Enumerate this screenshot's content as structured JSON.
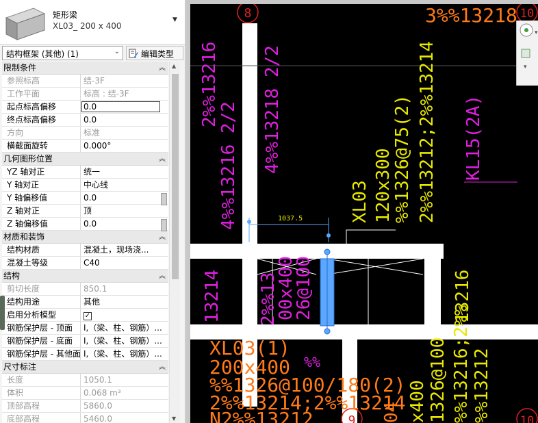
{
  "type_selector": {
    "family": "矩形梁",
    "type_name": "XL03_ 200 x 400"
  },
  "filter": {
    "selected": "结构框架 (其他) (1)",
    "edit_type_label": "编辑类型"
  },
  "groups": {
    "constraints": "限制条件",
    "geometry": "几何图形位置",
    "materials": "材质和装饰",
    "structural": "结构",
    "dimensions": "尺寸标注"
  },
  "rows": {
    "ref_level": {
      "label": "参照标高",
      "value": "结-3F"
    },
    "work_plane": {
      "label": "工作平面",
      "value": "标高 : 结-3F"
    },
    "start_offset": {
      "label": "起点标高偏移",
      "value": "0.0"
    },
    "end_offset": {
      "label": "终点标高偏移",
      "value": "0.0"
    },
    "orientation": {
      "label": "方向",
      "value": "标准"
    },
    "section_rotation": {
      "label": "横截面旋转",
      "value": "0.000°"
    },
    "yz_justify": {
      "label": "YZ 轴对正",
      "value": "统一"
    },
    "y_justify": {
      "label": "Y 轴对正",
      "value": "中心线"
    },
    "y_offset": {
      "label": "Y 轴偏移值",
      "value": "0.0"
    },
    "z_justify": {
      "label": "Z 轴对正",
      "value": "顶"
    },
    "z_offset": {
      "label": "Z 轴偏移值",
      "value": "0.0"
    },
    "struct_material": {
      "label": "结构材质",
      "value": "混凝土，现场浇..."
    },
    "concrete_grade": {
      "label": "混凝土等级",
      "value": "C40"
    },
    "cut_length": {
      "label": "剪切长度",
      "value": "850.1"
    },
    "struct_usage": {
      "label": "结构用途",
      "value": "其他"
    },
    "analytical_model": {
      "label": "启用分析模型",
      "value": "✓"
    },
    "rebar_cover_top": {
      "label": "钢筋保护层 - 顶面",
      "value": "I,（梁、柱、钢筋）..."
    },
    "rebar_cover_bottom": {
      "label": "钢筋保护层 - 底面",
      "value": "I,（梁、柱、钢筋）..."
    },
    "rebar_cover_other": {
      "label": "钢筋保护层 - 其他面",
      "value": "I,（梁、柱、钢筋）..."
    },
    "length": {
      "label": "长度",
      "value": "1050.1"
    },
    "volume": {
      "label": "体积",
      "value": "0.068 m³"
    },
    "top_elevation": {
      "label": "顶部高程",
      "value": "5860.0"
    },
    "bottom_elevation": {
      "label": "底部高程",
      "value": "5460.0"
    }
  },
  "cad": {
    "grid_8": "8",
    "grid_9": "9",
    "grid_10": "10",
    "dimension": "1037.5",
    "top_right": "3%%13218",
    "m1": "2%%13216",
    "m2": "4%%13218 2/2",
    "m3": "4%%13216 2/2",
    "m4": "13214",
    "m5": "2%%13",
    "m6": "00x400",
    "m7": "26@100",
    "y1": "XL03",
    "y2": "120x300",
    "y3": "%%1326@75(2)",
    "y4": "2%%13212;2%%13214",
    "y5": "13216",
    "y6": "x400",
    "y7": "1326@100",
    "y8": "%%13216;2%%",
    "y9": "%%13212",
    "kl15": "KL15(2A)",
    "o1": "XL03(1)",
    "o2": "200x400",
    "o3": "%%1326@100/180(2)",
    "o4": "2%%13214;2%%13214",
    "o5": "N2%%13212",
    "o6": "04",
    "p1": "%%"
  },
  "colors": {
    "magenta": "#e020e0",
    "yellow": "#e8e800",
    "orange": "#ff7a18",
    "selection": "#5aa8ff"
  }
}
